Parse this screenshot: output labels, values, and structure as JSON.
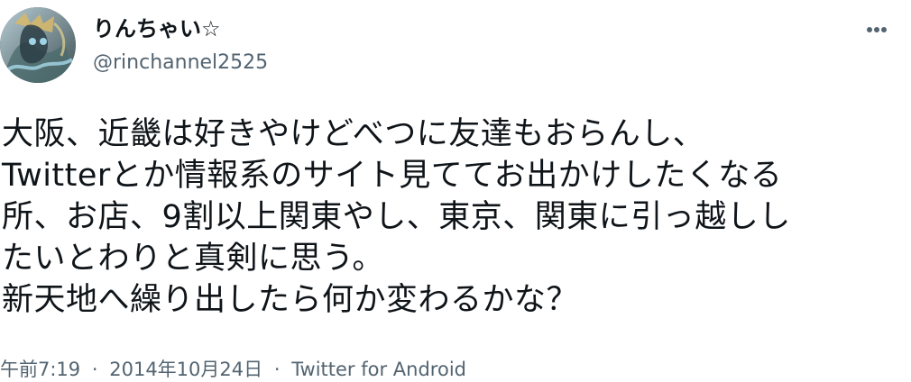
{
  "tweet": {
    "author": {
      "display_name": "りんちゃい☆",
      "handle": "@rinchannel2525",
      "avatar_icon": "profile-avatar"
    },
    "more_icon": "more-horizontal-icon",
    "text_lines": [
      "大阪、近畿は好きやけどべつに友達もおらんし、",
      "Twitterとか情報系のサイト見ててお出かけしたくなる",
      "所、お店、9割以上関東やし、東京、関東に引っ越しし",
      "たいとわりと真剣に思う。",
      "新天地へ繰り出したら何か変わるかな？"
    ],
    "meta": {
      "time": "午前7:19",
      "separator_1": "·",
      "date": "2014年10月24日",
      "separator_2": "·",
      "source": "Twitter for Android"
    }
  }
}
